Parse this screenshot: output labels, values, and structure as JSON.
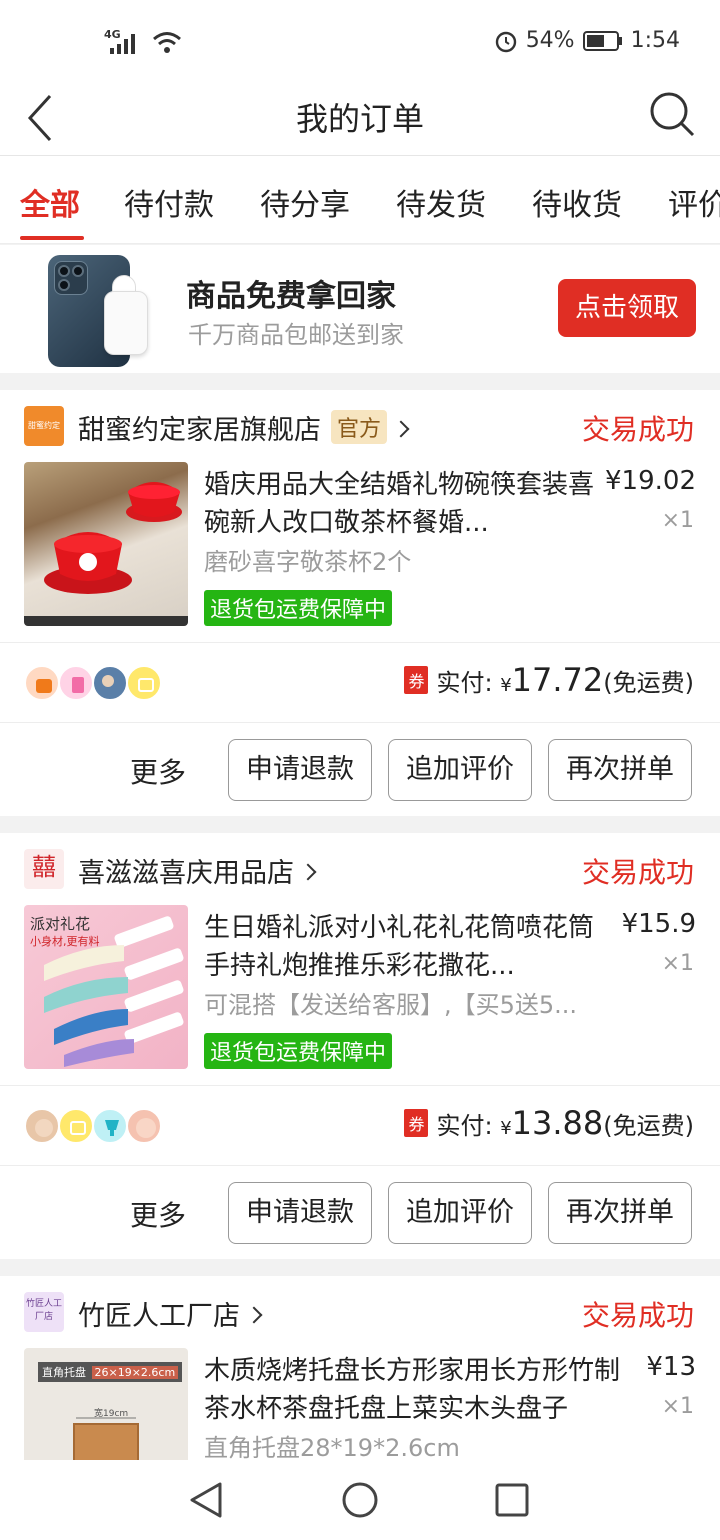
{
  "status_bar": {
    "battery": "54%",
    "time": "1:54",
    "network": "4G"
  },
  "header": {
    "title": "我的订单"
  },
  "tabs": [
    {
      "label": "全部"
    },
    {
      "label": "待付款"
    },
    {
      "label": "待分享"
    },
    {
      "label": "待发货"
    },
    {
      "label": "待收货"
    },
    {
      "label": "评价"
    }
  ],
  "promo": {
    "title": "商品免费拿回家",
    "subtitle": "千万商品包邮送到家",
    "button": "点击领取"
  },
  "orders": [
    {
      "store": "甜蜜约定家居旗舰店",
      "store_logo_text": "甜蜜约定",
      "official_tag": "官方",
      "status": "交易成功",
      "title": "婚庆用品大全结婚礼物碗筷套装喜碗新人改口敬茶杯餐婚...",
      "spec": "磨砂喜字敬茶杯2个",
      "badge": "退货包运费保障中",
      "price": "¥19.02",
      "qty": "×1",
      "paid_label": "实付:",
      "coupon": "券",
      "currency": "¥",
      "paid_amount": "17.72",
      "shipping": "(免运费)",
      "more": "更多",
      "btn_refund": "申请退款",
      "btn_review": "追加评价",
      "btn_reorder": "再次拼单"
    },
    {
      "store": "喜滋滋喜庆用品店",
      "store_logo_text": "囍",
      "status": "交易成功",
      "title": "生日婚礼派对小礼花礼花筒喷花筒手持礼炮推推乐彩花撒花...",
      "spec": "可混搭【发送给客服】,【买5送5...",
      "badge": "退货包运费保障中",
      "price": "¥15.9",
      "qty": "×1",
      "paid_label": "实付:",
      "coupon": "券",
      "currency": "¥",
      "paid_amount": "13.88",
      "shipping": "(免运费)",
      "more": "更多",
      "btn_refund": "申请退款",
      "btn_review": "追加评价",
      "btn_reorder": "再次拼单",
      "thumb_text": "派对礼花",
      "thumb_sub": "小身材,更有料"
    },
    {
      "store": "竹匠人工厂店",
      "store_logo_text": "竹匠人工厂店",
      "status": "交易成功",
      "title": "木质烧烤托盘长方形家用长方形竹制茶水杯茶盘托盘上菜实木头盘子",
      "spec": "直角托盘28*19*2.6cm",
      "price": "¥13",
      "qty": "×1",
      "thumb_text": "直角托盘",
      "thumb_sub": "26×19×2.6cm",
      "thumb_measure": "宽19cm"
    }
  ]
}
